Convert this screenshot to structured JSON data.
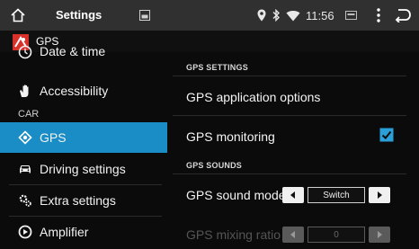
{
  "statusbar": {
    "title": "Settings",
    "time": "11:56"
  },
  "subheader": {
    "title": "GPS"
  },
  "sidebar": {
    "partial_item": "Date & time",
    "items": [
      {
        "label": "Accessibility",
        "icon": "hand-icon"
      },
      {
        "label": "GPS",
        "icon": "gps-icon",
        "active": true
      },
      {
        "label": "Driving settings",
        "icon": "car-icon"
      },
      {
        "label": "Extra settings",
        "icon": "gears-icon"
      },
      {
        "label": "Amplifier",
        "icon": "amplifier-icon"
      }
    ],
    "category": "CAR"
  },
  "content": {
    "gps_settings_header": "GPS SETTINGS",
    "gps_application_options": "GPS application options",
    "gps_monitoring": {
      "label": "GPS monitoring",
      "checked": true
    },
    "gps_sounds_header": "GPS SOUNDS",
    "gps_sound_mode": {
      "label": "GPS sound mode",
      "value": "Switch"
    },
    "gps_mixing_ratio": {
      "label": "GPS mixing ratio",
      "value": "0",
      "disabled": true
    }
  },
  "colors": {
    "accent": "#1a8dc7",
    "check": "#2a9fd8",
    "background": "#0b0b0b",
    "topbar": "#303030"
  }
}
